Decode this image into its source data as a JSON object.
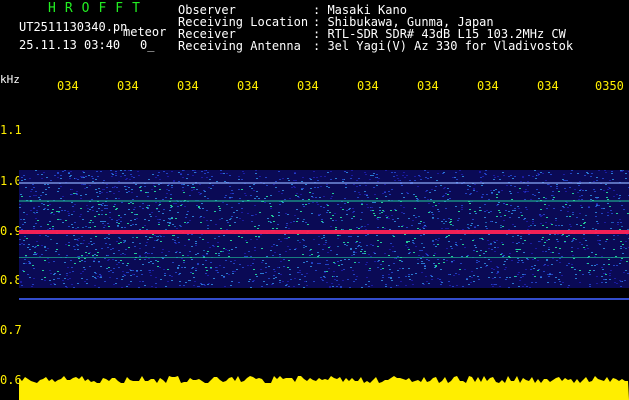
{
  "header": {
    "brand": "HROFFT",
    "filename": "UT2511130340.pn",
    "mode": "meteor",
    "datetime": "25.11.13 03:40",
    "extra": "0_",
    "meta": [
      {
        "key": "Observer",
        "value": ": Masaki Kano"
      },
      {
        "key": "Receiving Location",
        "value": ": Shibukawa, Gunma, Japan"
      },
      {
        "key": "Receiver",
        "value": ": RTL-SDR SDR# 43dB L15 103.2MHz CW"
      },
      {
        "key": "Receiving Antenna",
        "value": ": 3el Yagi(V) Az 330 for Vladivostok"
      }
    ]
  },
  "axis": {
    "unit": "kHz",
    "x_ticks": [
      "034",
      "034",
      "034",
      "034",
      "034",
      "034",
      "034",
      "034",
      "034",
      "0350"
    ],
    "y_ticks": [
      "1.1",
      "1.0",
      "0.9",
      "0.8",
      "0.7",
      "0.6"
    ]
  },
  "colors": {
    "background": "#000000",
    "label": "#ffee00",
    "brand": "#22ee22",
    "carrier": "#ff2255",
    "noise_low": "#1a1aa0",
    "noise_high": "#22cc99",
    "level_bar": "#ffee00"
  }
}
